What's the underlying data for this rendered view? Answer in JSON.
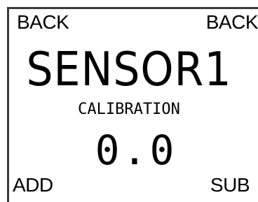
{
  "softkeys": {
    "top_left": "BACK",
    "top_right": "BACK",
    "bottom_left": "ADD",
    "bottom_right": "SUB"
  },
  "display": {
    "sensor_name": "SENSOR1",
    "mode": "CALIBRATION",
    "value": "0.0"
  },
  "colors": {
    "background": "#ffffff",
    "text": "#000000",
    "frame": "#3a3a3a"
  }
}
